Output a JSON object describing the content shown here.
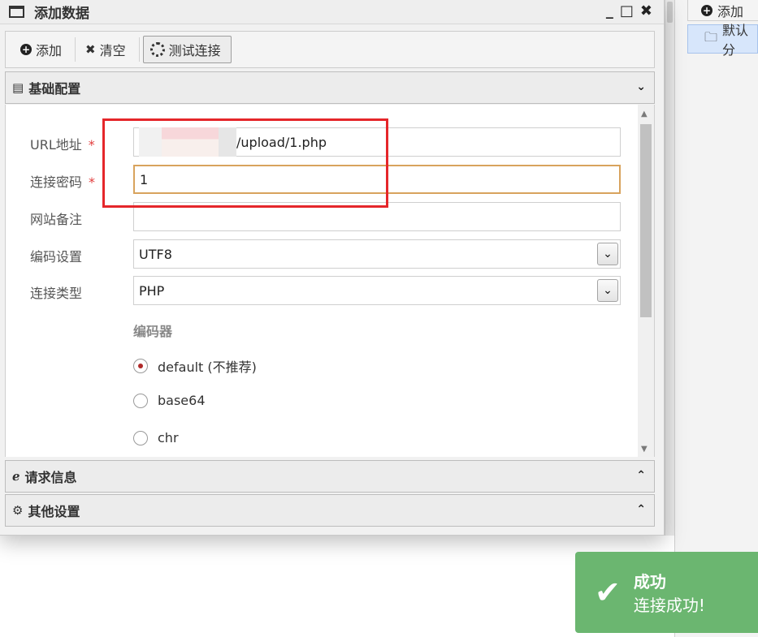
{
  "window": {
    "title": "添加数据",
    "controls": {
      "minimize": "_",
      "maximize": "□",
      "close": "✖"
    }
  },
  "toolbar": {
    "add_label": "添加",
    "clear_label": "清空",
    "test_label": "测试连接"
  },
  "sections": {
    "basic": "基础配置",
    "request": "请求信息",
    "other": "其他设置"
  },
  "form": {
    "url": {
      "label": "URL地址",
      "required": "*",
      "value": "/upload/1.php"
    },
    "password": {
      "label": "连接密码",
      "required": "*",
      "value": "1"
    },
    "note": {
      "label": "网站备注",
      "value": ""
    },
    "encoding": {
      "label": "编码设置",
      "value": "UTF8"
    },
    "type": {
      "label": "连接类型",
      "value": "PHP"
    },
    "encoder": {
      "label": "编码器",
      "options": [
        "default (不推荐)",
        "base64",
        "chr"
      ],
      "selected": "default (不推荐)"
    }
  },
  "background": {
    "toolbar_add": "添加",
    "list_item": "默认分"
  },
  "toast": {
    "title": "成功",
    "message": "连接成功!"
  },
  "colors": {
    "accent_focus": "#d8a35d",
    "required": "#e23d3d",
    "toast_bg": "#6bb670",
    "highlight_box": "#e5262a"
  }
}
